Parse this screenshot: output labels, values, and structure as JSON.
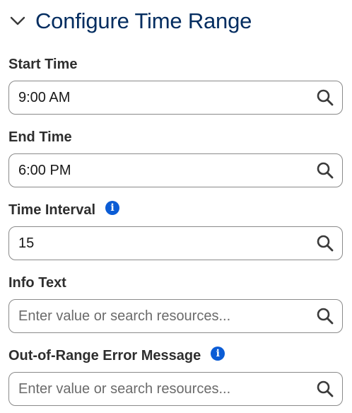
{
  "section": {
    "title": "Configure Time Range",
    "expand_icon": "chevron-down-icon"
  },
  "fields": {
    "start_time": {
      "label": "Start Time",
      "value": "9:00 AM"
    },
    "end_time": {
      "label": "End Time",
      "value": "6:00 PM"
    },
    "time_interval": {
      "label": "Time Interval",
      "value": "15",
      "info": "i"
    },
    "info_text": {
      "label": "Info Text",
      "placeholder": "Enter value or search resources..."
    },
    "error_message": {
      "label": "Out-of-Range Error Message",
      "placeholder": "Enter value or search resources...",
      "info": "i"
    }
  },
  "colors": {
    "title": "#032d60",
    "info_icon": "#0b5cd5",
    "border": "#8a8a8a"
  }
}
